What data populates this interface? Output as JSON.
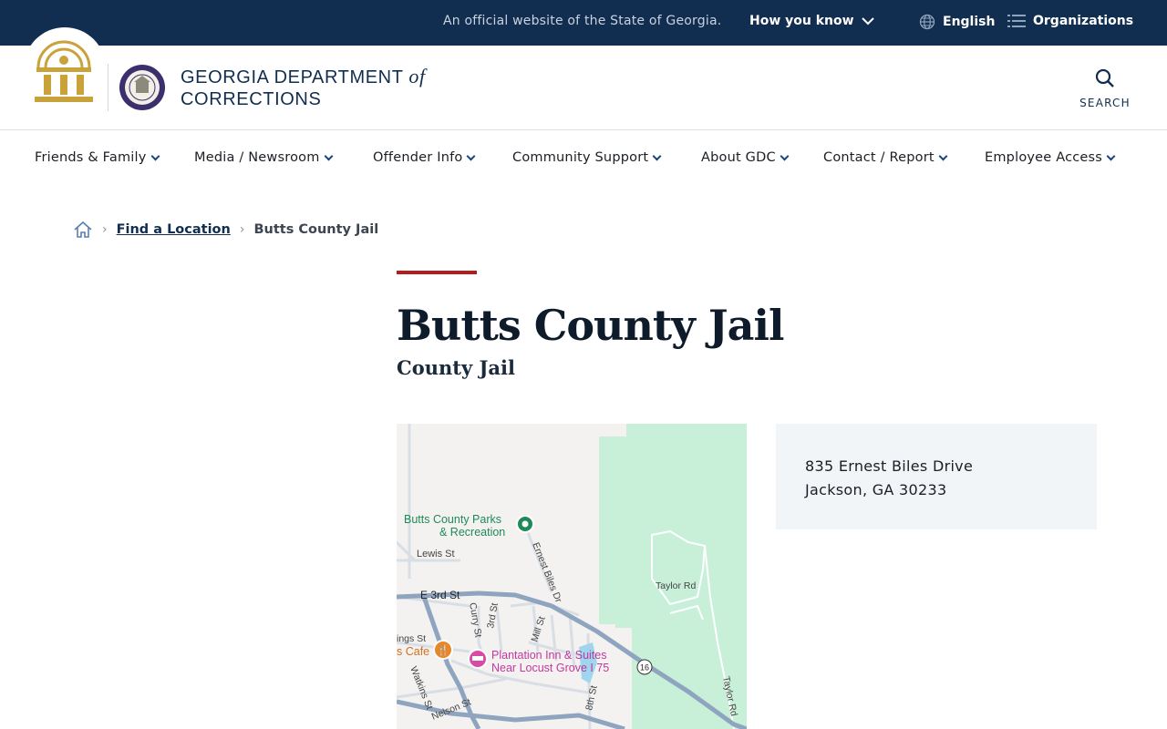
{
  "topbar": {
    "official_text": "An official website of the State of Georgia.",
    "how_you_know": "How you know",
    "language": "English",
    "organizations": "Organizations"
  },
  "header": {
    "dept_line1": "GEORGIA DEPARTMENT",
    "dept_of": "of",
    "dept_line2": "CORRECTIONS",
    "search_label": "SEARCH"
  },
  "nav": {
    "items": [
      {
        "label": "Friends & Family"
      },
      {
        "label": "Media / Newsroom"
      },
      {
        "label": "Offender Info"
      },
      {
        "label": "Community Support"
      },
      {
        "label": "About GDC"
      },
      {
        "label": "Contact / Report"
      },
      {
        "label": "Employee Access"
      }
    ]
  },
  "breadcrumb": {
    "link": "Find a Location",
    "current": "Butts County Jail"
  },
  "page": {
    "title": "Butts County Jail",
    "subtitle": "County Jail"
  },
  "map": {
    "labels": {
      "parks": "Butts County Parks",
      "parks2": "& Recreation",
      "lewis": "Lewis St",
      "ernest": "Ernest Biles Dr",
      "taylor1": "Taylor Rd",
      "taylor2": "Taylor Rd",
      "e3rd": "E 3rd St",
      "curry": "Curry St",
      "third": "3rd St",
      "mill": "Mill St",
      "ings": "ings St",
      "cafe": "s Cafe",
      "watkins": "Watkins St",
      "nelson": "Nelson St",
      "eighth": "8th St",
      "hotel1": "Plantation Inn & Suites",
      "hotel2": "Near Locust Grove I 75",
      "route": "16"
    },
    "colors": {
      "park": "#c8f0d8",
      "road_major": "#8fa4bf",
      "hotel_text": "#c2389e",
      "park_text": "#1e8a5a",
      "cafe_pin": "#e8862a"
    }
  },
  "address": {
    "line1": "835 Ernest Biles Drive",
    "line2": "Jackson, GA 30233"
  },
  "colors": {
    "navy": "#112e51",
    "accent_red": "#b51d1d",
    "gold": "#c9a23a"
  }
}
